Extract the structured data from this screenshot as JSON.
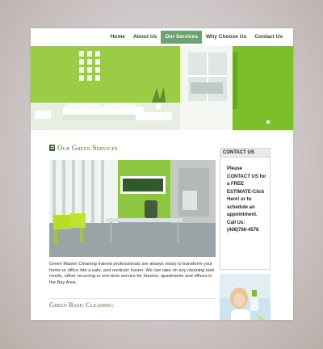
{
  "nav": {
    "items": [
      {
        "label": "Home",
        "active": false
      },
      {
        "label": "About Us",
        "active": false
      },
      {
        "label": "Our Services",
        "active": true
      },
      {
        "label": "Why Choose Us",
        "active": false
      },
      {
        "label": "Contact Us",
        "active": false
      }
    ]
  },
  "main": {
    "section_title": "Our Green Services",
    "description": "Green Master Cleaning trained professionals are always ready to transform your home or office into a safe, and nontoxic haven. We can take on any cleaning task needs, either recurring or one-time service for houses, apartments and offices in the Bay Area.",
    "subsection_title": "Green Basic Cleaning:"
  },
  "sidebar": {
    "contact_header": "CONTACT US",
    "contact_text": "Please CONTACT US for a FREE ESTIMATE-Click Here! or to schedule an appointment. Call Us: (408)766-4578"
  },
  "colors": {
    "accent": "#6aa36e",
    "hero_green": "#8dc63f",
    "title_green": "#4a6d31"
  }
}
